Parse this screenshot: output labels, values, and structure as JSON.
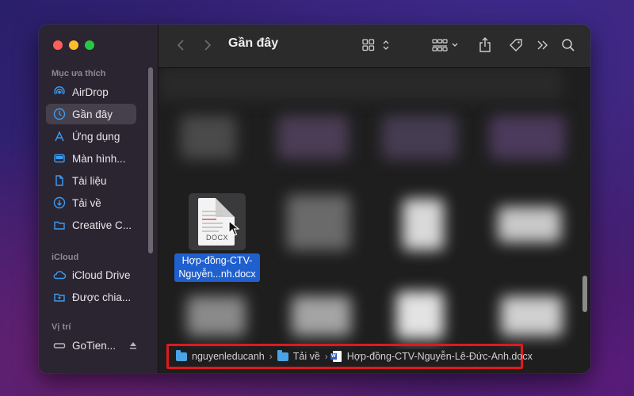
{
  "window": {
    "title": "Gần đây"
  },
  "sidebar": {
    "sections": [
      {
        "header": "Mục ưa thích",
        "items": [
          {
            "label": "AirDrop",
            "icon": "airdrop-icon"
          },
          {
            "label": "Gần đây",
            "icon": "clock-icon",
            "active": true
          },
          {
            "label": "Ứng dụng",
            "icon": "applications-icon"
          },
          {
            "label": "Màn hình...",
            "icon": "desktop-icon"
          },
          {
            "label": "Tài liệu",
            "icon": "document-icon"
          },
          {
            "label": "Tải về",
            "icon": "download-icon"
          },
          {
            "label": "Creative C...",
            "icon": "folder-icon"
          }
        ]
      },
      {
        "header": "iCloud",
        "items": [
          {
            "label": "iCloud Drive",
            "icon": "cloud-icon"
          },
          {
            "label": "Được chia...",
            "icon": "shared-folder-icon"
          }
        ]
      },
      {
        "header": "Vị trí",
        "items": [
          {
            "label": "GoTien...",
            "icon": "disk-icon"
          }
        ]
      }
    ]
  },
  "selected_file": {
    "label_line1": "Hợp-đồng-CTV-",
    "label_line2": "Nguyễn...nh.docx",
    "thumb_tag": "DOCX"
  },
  "pathbar": {
    "segments": [
      {
        "label": "nguyenleducanh",
        "icon": "folder-icon"
      },
      {
        "label": "Tải về",
        "icon": "folder-icon"
      },
      {
        "label": "Hợp-đồng-CTV-Nguyễn-Lê-Đức-Anh.docx",
        "icon": "word-document-icon"
      }
    ],
    "separator": "›"
  },
  "colors": {
    "selection": "#1f5fce",
    "highlight_border": "#e0191f",
    "folder": "#4aa3e6"
  }
}
